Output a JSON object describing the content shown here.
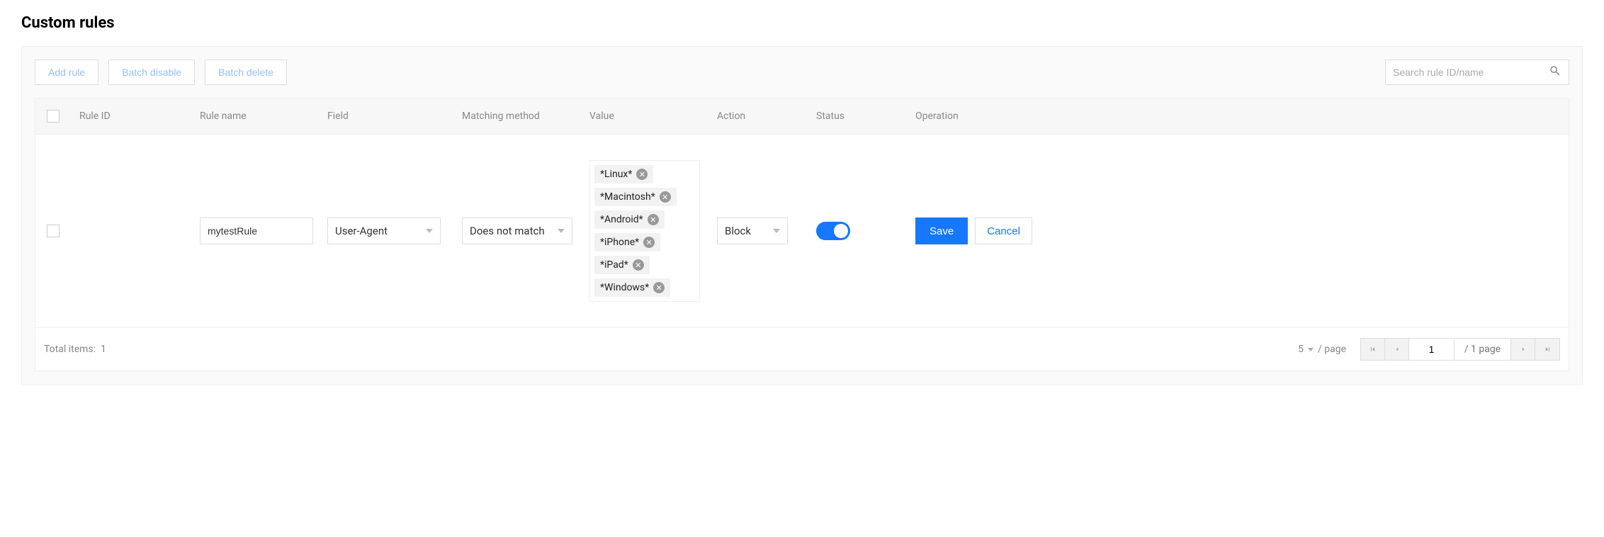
{
  "title": "Custom rules",
  "toolbar": {
    "add": "Add rule",
    "batch_disable": "Batch disable",
    "batch_delete": "Batch delete",
    "search_placeholder": "Search rule ID/name"
  },
  "headers": {
    "rule_id": "Rule ID",
    "rule_name": "Rule name",
    "field": "Field",
    "matching_method": "Matching method",
    "value": "Value",
    "action": "Action",
    "status": "Status",
    "operation": "Operation"
  },
  "row": {
    "rule_name": "mytestRule",
    "field": "User-Agent",
    "matching_method": "Does not match",
    "values": {
      "v0": "*Linux*",
      "v1": "*Macintosh*",
      "v2": "*Android*",
      "v3": "*iPhone*",
      "v4": "*iPad*",
      "v5": "*Windows*"
    },
    "action": "Block",
    "save": "Save",
    "cancel": "Cancel"
  },
  "footer": {
    "total_label": "Total items:",
    "total_count": "1",
    "per_page_value": "5",
    "per_page_label": "/ page",
    "current_page": "1",
    "total_pages": "/ 1 page"
  }
}
